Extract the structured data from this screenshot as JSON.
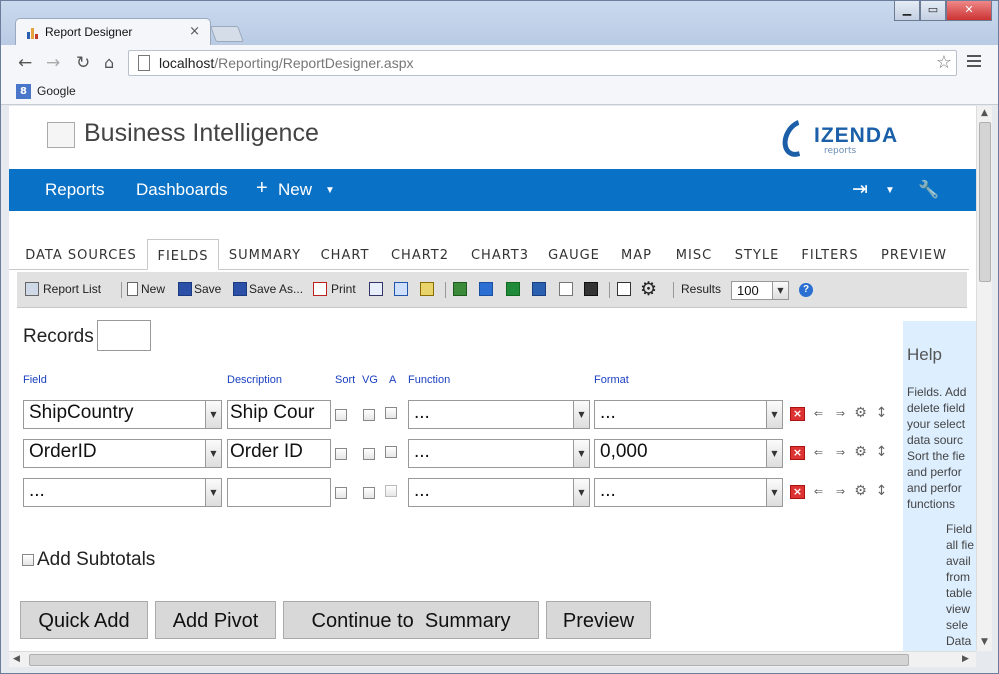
{
  "browser": {
    "tab_title": "Report Designer",
    "url_host": "localhost",
    "url_path": "/Reporting/ReportDesigner.aspx",
    "bookmark": "Google"
  },
  "header": {
    "title": "Business Intelligence",
    "logo_word": "IZENDA",
    "logo_sub": "reports"
  },
  "nav": {
    "reports": "Reports",
    "dashboards": "Dashboards",
    "new": "New"
  },
  "tabs": [
    "DATA SOURCES",
    "FIELDS",
    "SUMMARY",
    "CHART",
    "CHART2",
    "CHART3",
    "GAUGE",
    "MAP",
    "MISC",
    "STYLE",
    "FILTERS",
    "PREVIEW"
  ],
  "active_tab": "FIELDS",
  "toolbar": {
    "report_list": "Report List",
    "new": "New",
    "save": "Save",
    "save_as": "Save As...",
    "print": "Print",
    "results_label": "Results",
    "results_value": "100"
  },
  "records_label": "Records",
  "columns": {
    "field": "Field",
    "description": "Description",
    "sort": "Sort",
    "vg": "VG",
    "a": "A",
    "function": "Function",
    "format": "Format"
  },
  "rows": [
    {
      "field": "ShipCountry",
      "description": "Ship Cour",
      "function": "...",
      "format": "..."
    },
    {
      "field": "OrderID",
      "description": "Order ID",
      "function": "...",
      "format": "0,000"
    },
    {
      "field": "...",
      "description": "",
      "function": "...",
      "format": "..."
    }
  ],
  "add_subtotals": "Add Subtotals",
  "buttons": {
    "quick_add": "Quick Add",
    "add_pivot": "Add Pivot",
    "continue": "Continue to  Summary",
    "preview": "Preview"
  },
  "help": {
    "title": "Help",
    "text": "Fields. Add\ndelete field\nyour select\ndata sourc\nSort the fie\nand perfor\nand perfor\nfunctions",
    "text2": "Field\nall fie\navail\nfrom\ntable\nview\nsele\nData"
  },
  "colors": {
    "accent": "#0a72c6",
    "help_bg": "#ddeeff"
  }
}
